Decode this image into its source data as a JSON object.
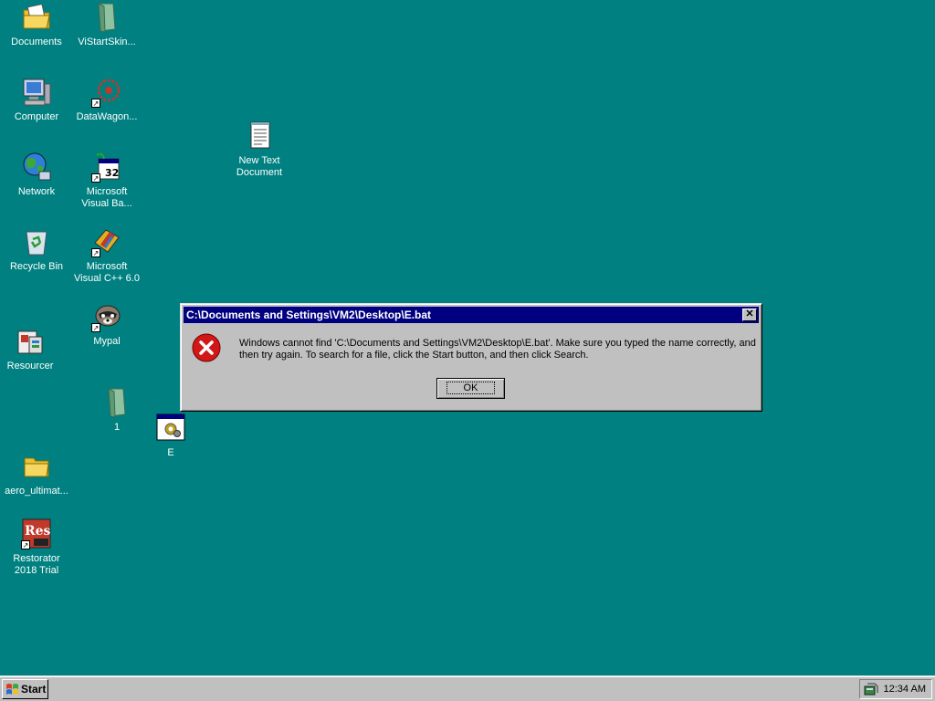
{
  "desktop": {
    "background": "#008080",
    "icons": [
      {
        "label": "Documents",
        "icon": "folder-documents-icon"
      },
      {
        "label": "ViStartSkin...",
        "icon": "green-file-icon"
      },
      {
        "label": "Computer",
        "icon": "computer-icon"
      },
      {
        "label": "DataWagon...",
        "icon": "datawagon-icon"
      },
      {
        "label": "Network",
        "icon": "network-globe-icon"
      },
      {
        "label": "Microsoft\nVisual Ba...",
        "icon": "visual-basic-icon"
      },
      {
        "label": "Recycle Bin",
        "icon": "recycle-bin-icon"
      },
      {
        "label": "Microsoft\nVisual C++ 6.0",
        "icon": "visual-cpp-icon"
      },
      {
        "label": "Mypal",
        "icon": "mypal-raccoon-icon"
      },
      {
        "label": "Resourcer",
        "icon": "resourcer-icon"
      },
      {
        "label": "1",
        "icon": "green-file-icon"
      },
      {
        "label": "E",
        "icon": "batch-file-icon"
      },
      {
        "label": "aero_ultimat...",
        "icon": "folder-icon"
      },
      {
        "label": "Restorator\n2018 Trial",
        "icon": "restorator-icon"
      },
      {
        "label": "New Text\nDocument",
        "icon": "text-document-icon"
      }
    ]
  },
  "dialog": {
    "title": "C:\\Documents and Settings\\VM2\\Desktop\\E.bat",
    "close_label": "✕",
    "message": "Windows cannot find 'C:\\Documents and Settings\\VM2\\Desktop\\E.bat'. Make sure you typed the name correctly, and then try again. To search for a file, click the Start button, and then click Search.",
    "ok_label": "OK",
    "icon": "error-icon"
  },
  "taskbar": {
    "start_label": "Start",
    "clock": "12:34 AM"
  }
}
